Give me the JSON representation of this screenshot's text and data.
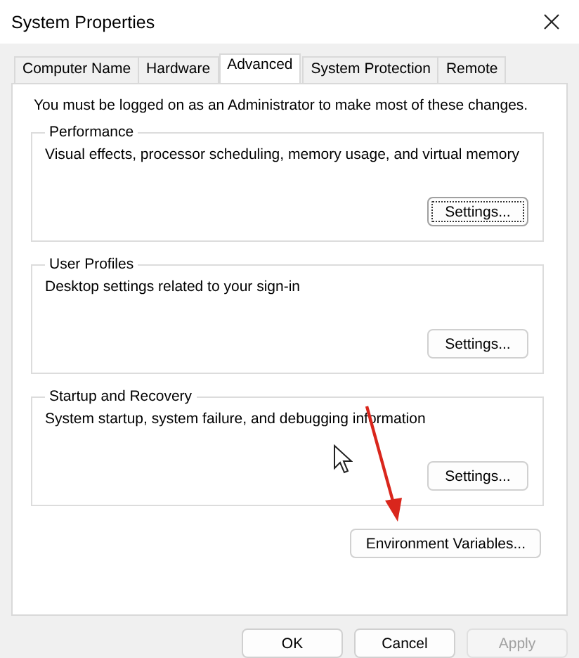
{
  "window": {
    "title": "System Properties"
  },
  "tabs": [
    {
      "label": "Computer Name",
      "selected": false
    },
    {
      "label": "Hardware",
      "selected": false
    },
    {
      "label": "Advanced",
      "selected": true
    },
    {
      "label": "System Protection",
      "selected": false
    },
    {
      "label": "Remote",
      "selected": false
    }
  ],
  "notice": "You must be logged on as an Administrator to make most of these changes.",
  "groups": [
    {
      "title": "Performance",
      "description": "Visual effects, processor scheduling, memory usage, and virtual memory",
      "button": {
        "label": "Settings...",
        "focused": true
      }
    },
    {
      "title": "User Profiles",
      "description": "Desktop settings related to your sign-in",
      "button": {
        "label": "Settings...",
        "focused": false
      }
    },
    {
      "title": "Startup and Recovery",
      "description": "System startup, system failure, and debugging information",
      "button": {
        "label": "Settings...",
        "focused": false
      }
    }
  ],
  "environment_button": {
    "label": "Environment Variables...",
    "focused": false
  },
  "dialog_buttons": [
    {
      "label": "OK",
      "disabled": false
    },
    {
      "label": "Cancel",
      "disabled": false
    },
    {
      "label": "Apply",
      "disabled": true
    }
  ]
}
